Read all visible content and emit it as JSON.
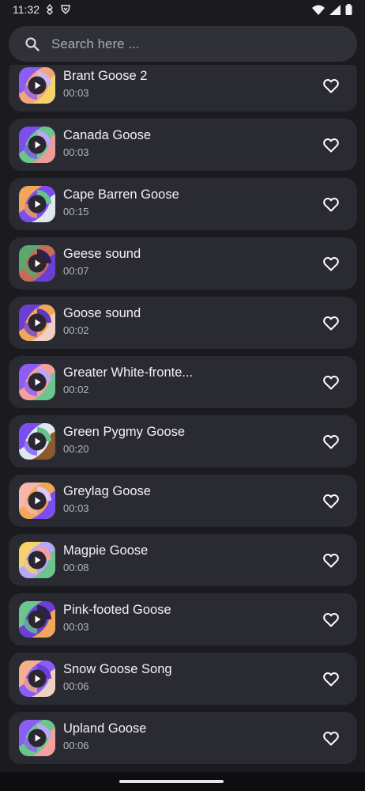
{
  "status_bar": {
    "time": "11:32",
    "icons": [
      "vpn-icon",
      "shield-icon",
      "wifi-icon",
      "signal-icon",
      "battery-icon"
    ]
  },
  "search": {
    "placeholder": "Search here ...",
    "value": ""
  },
  "sounds": [
    {
      "title": "Brant Goose 2",
      "duration": "00:03",
      "palette": [
        "#f1a77a",
        "#8b5cf6",
        "#f5d36b",
        "#cbb8f2"
      ]
    },
    {
      "title": "Canada Goose",
      "duration": "00:03",
      "palette": [
        "#6bc58c",
        "#7c4df0",
        "#f09a9a",
        "#b9a6f4"
      ]
    },
    {
      "title": "Cape Barren Goose",
      "duration": "00:15",
      "palette": [
        "#7c4df0",
        "#f2a65a",
        "#dfe7f0",
        "#64c38a"
      ]
    },
    {
      "title": "Geese sound",
      "duration": "00:07",
      "palette": [
        "#c76a5a",
        "#5aa86d",
        "#6b3fd6",
        "#2f2050"
      ]
    },
    {
      "title": "Goose sound",
      "duration": "00:02",
      "palette": [
        "#f2a65a",
        "#6b3fd6",
        "#f0d0c0",
        "#5a3bc0"
      ]
    },
    {
      "title": "Greater White-fronte...",
      "duration": "00:02",
      "palette": [
        "#f5a09a",
        "#8b5cf6",
        "#6bc58c",
        "#b9a6f4"
      ]
    },
    {
      "title": "Green Pygmy Goose",
      "duration": "00:20",
      "palette": [
        "#dfe7f0",
        "#7c4df0",
        "#8a5a2a",
        "#64c38a"
      ]
    },
    {
      "title": "Greylag Goose",
      "duration": "00:03",
      "palette": [
        "#f2a65a",
        "#f5b6b0",
        "#7c4df0",
        "#dcc8f5"
      ]
    },
    {
      "title": "Magpie Goose",
      "duration": "00:08",
      "palette": [
        "#b9a6f4",
        "#f5d36b",
        "#6bc58c",
        "#f2a0a0"
      ]
    },
    {
      "title": "Pink-footed Goose",
      "duration": "00:03",
      "palette": [
        "#6b3fd6",
        "#6bc58c",
        "#f2a65a",
        "#2f2050"
      ]
    },
    {
      "title": "Snow Goose Song",
      "duration": "00:06",
      "palette": [
        "#8b5cf6",
        "#f5b08a",
        "#f0d0c0",
        "#6b3fd6"
      ]
    },
    {
      "title": "Upland Goose",
      "duration": "00:06",
      "palette": [
        "#6bc58c",
        "#8b5cf6",
        "#f2a0a0",
        "#b9a6f4"
      ]
    }
  ],
  "colors": {
    "background": "#1b1b1f",
    "card": "#2a2b32",
    "search_field": "#2f3038",
    "play_button": "#2b2630"
  }
}
